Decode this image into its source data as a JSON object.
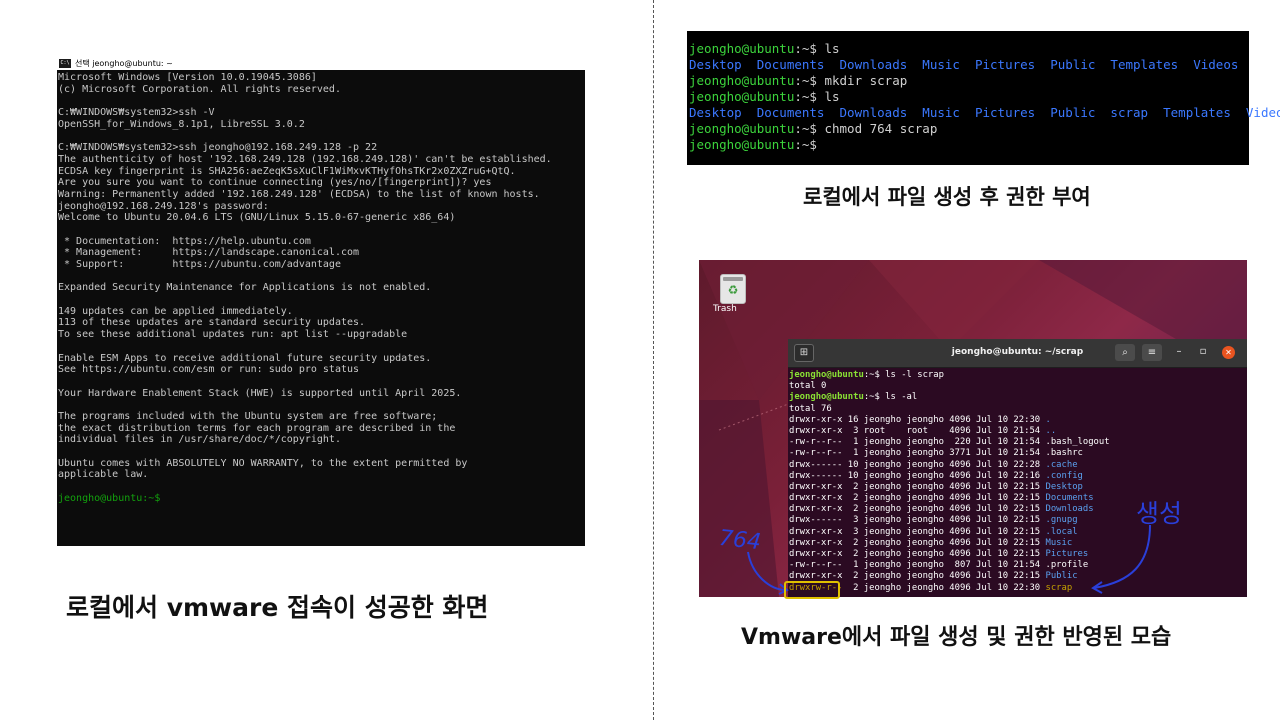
{
  "left_panel": {
    "window_title": "선택 jeongho@ubuntu: ~",
    "icon": "cmd-icon",
    "lines": [
      {
        "t": "Microsoft Windows [Version 10.0.19045.3086]",
        "c": ""
      },
      {
        "t": "(c) Microsoft Corporation. All rights reserved.",
        "c": ""
      },
      {
        "t": "",
        "c": ""
      },
      {
        "t": "C:₩WINDOWS₩system32>ssh -V",
        "c": ""
      },
      {
        "t": "OpenSSH_for_Windows_8.1p1, LibreSSL 3.0.2",
        "c": ""
      },
      {
        "t": "",
        "c": ""
      },
      {
        "t": "C:₩WINDOWS₩system32>ssh jeongho@192.168.249.128 -p 22",
        "c": ""
      },
      {
        "t": "The authenticity of host '192.168.249.128 (192.168.249.128)' can't be established.",
        "c": ""
      },
      {
        "t": "ECDSA key fingerprint is SHA256:aeZeqK5sXuClF1WiMxvKTHyfOhsTKr2x0ZXZruG+QtQ.",
        "c": ""
      },
      {
        "t": "Are you sure you want to continue connecting (yes/no/[fingerprint])? yes",
        "c": ""
      },
      {
        "t": "Warning: Permanently added '192.168.249.128' (ECDSA) to the list of known hosts.",
        "c": ""
      },
      {
        "t": "jeongho@192.168.249.128's password:",
        "c": ""
      },
      {
        "t": "Welcome to Ubuntu 20.04.6 LTS (GNU/Linux 5.15.0-67-generic x86_64)",
        "c": ""
      },
      {
        "t": "",
        "c": ""
      },
      {
        "t": " * Documentation:  https://help.ubuntu.com",
        "c": ""
      },
      {
        "t": " * Management:     https://landscape.canonical.com",
        "c": ""
      },
      {
        "t": " * Support:        https://ubuntu.com/advantage",
        "c": ""
      },
      {
        "t": "",
        "c": ""
      },
      {
        "t": "Expanded Security Maintenance for Applications is not enabled.",
        "c": ""
      },
      {
        "t": "",
        "c": ""
      },
      {
        "t": "149 updates can be applied immediately.",
        "c": ""
      },
      {
        "t": "113 of these updates are standard security updates.",
        "c": ""
      },
      {
        "t": "To see these additional updates run: apt list --upgradable",
        "c": ""
      },
      {
        "t": "",
        "c": ""
      },
      {
        "t": "Enable ESM Apps to receive additional future security updates.",
        "c": ""
      },
      {
        "t": "See https://ubuntu.com/esm or run: sudo pro status",
        "c": ""
      },
      {
        "t": "",
        "c": ""
      },
      {
        "t": "Your Hardware Enablement Stack (HWE) is supported until April 2025.",
        "c": ""
      },
      {
        "t": "",
        "c": ""
      },
      {
        "t": "The programs included with the Ubuntu system are free software;",
        "c": ""
      },
      {
        "t": "the exact distribution terms for each program are described in the",
        "c": ""
      },
      {
        "t": "individual files in /usr/share/doc/*/copyright.",
        "c": ""
      },
      {
        "t": "",
        "c": ""
      },
      {
        "t": "Ubuntu comes with ABSOLUTELY NO WARRANTY, to the extent permitted by",
        "c": ""
      },
      {
        "t": "applicable law.",
        "c": ""
      },
      {
        "t": "",
        "c": ""
      },
      {
        "t": "jeongho@ubuntu:~$",
        "c": "green"
      }
    ],
    "caption": "로컬에서 vmware 접속이 성공한 화면"
  },
  "right_top": {
    "lines": [
      [
        {
          "t": "jeongho@ubuntu",
          "c": "g"
        },
        {
          "t": ":~$ ls",
          "c": ""
        }
      ],
      [
        {
          "t": "Desktop  Documents  Downloads  Music  Pictures  Public  Templates  Videos",
          "c": "b"
        }
      ],
      [
        {
          "t": "jeongho@ubuntu",
          "c": "g"
        },
        {
          "t": ":~$ mkdir scrap",
          "c": ""
        }
      ],
      [
        {
          "t": "jeongho@ubuntu",
          "c": "g"
        },
        {
          "t": ":~$ ls",
          "c": ""
        }
      ],
      [
        {
          "t": "Desktop  Documents  Downloads  Music  Pictures  Public  scrap  Templates  Videos",
          "c": "b"
        }
      ],
      [
        {
          "t": "jeongho@ubuntu",
          "c": "g"
        },
        {
          "t": ":~$ chmod 764 scrap",
          "c": ""
        }
      ],
      [
        {
          "t": "jeongho@ubuntu",
          "c": "g"
        },
        {
          "t": ":~$",
          "c": ""
        }
      ]
    ],
    "caption": "로컬에서 파일 생성 후 권한 부여"
  },
  "right_bottom": {
    "desktop_icon_label": "Trash",
    "terminal_title": "jeongho@ubuntu: ~/scrap",
    "lines": [
      [
        {
          "t": "jeongho@ubuntu",
          "c": "ug"
        },
        {
          "t": ":~$ ls -l scrap",
          "c": ""
        }
      ],
      [
        {
          "t": "total 0",
          "c": ""
        }
      ],
      [
        {
          "t": "jeongho@ubuntu",
          "c": "ug"
        },
        {
          "t": ":~$ ls -al",
          "c": ""
        }
      ],
      [
        {
          "t": "total 76",
          "c": ""
        }
      ],
      [
        {
          "t": "drwxr-xr-x 16 jeongho jeongho 4096 Jul 10 22:30 ",
          "c": ""
        },
        {
          "t": ".",
          "c": "ub"
        }
      ],
      [
        {
          "t": "drwxr-xr-x  3 root    root    4096 Jul 10 21:54 ",
          "c": ""
        },
        {
          "t": "..",
          "c": "ub"
        }
      ],
      [
        {
          "t": "-rw-r--r--  1 jeongho jeongho  220 Jul 10 21:54 .bash_logout",
          "c": ""
        }
      ],
      [
        {
          "t": "-rw-r--r--  1 jeongho jeongho 3771 Jul 10 21:54 .bashrc",
          "c": ""
        }
      ],
      [
        {
          "t": "drwx------ 10 jeongho jeongho 4096 Jul 10 22:28 ",
          "c": ""
        },
        {
          "t": ".cache",
          "c": "ub"
        }
      ],
      [
        {
          "t": "drwx------ 10 jeongho jeongho 4096 Jul 10 22:16 ",
          "c": ""
        },
        {
          "t": ".config",
          "c": "ub"
        }
      ],
      [
        {
          "t": "drwxr-xr-x  2 jeongho jeongho 4096 Jul 10 22:15 ",
          "c": ""
        },
        {
          "t": "Desktop",
          "c": "ub"
        }
      ],
      [
        {
          "t": "drwxr-xr-x  2 jeongho jeongho 4096 Jul 10 22:15 ",
          "c": ""
        },
        {
          "t": "Documents",
          "c": "ub"
        }
      ],
      [
        {
          "t": "drwxr-xr-x  2 jeongho jeongho 4096 Jul 10 22:15 ",
          "c": ""
        },
        {
          "t": "Downloads",
          "c": "ub"
        }
      ],
      [
        {
          "t": "drwx------  3 jeongho jeongho 4096 Jul 10 22:15 ",
          "c": ""
        },
        {
          "t": ".gnupg",
          "c": "ub"
        }
      ],
      [
        {
          "t": "drwxr-xr-x  3 jeongho jeongho 4096 Jul 10 22:15 ",
          "c": ""
        },
        {
          "t": ".local",
          "c": "ub"
        }
      ],
      [
        {
          "t": "drwxr-xr-x  2 jeongho jeongho 4096 Jul 10 22:15 ",
          "c": ""
        },
        {
          "t": "Music",
          "c": "ub"
        }
      ],
      [
        {
          "t": "drwxr-xr-x  2 jeongho jeongho 4096 Jul 10 22:15 ",
          "c": ""
        },
        {
          "t": "Pictures",
          "c": "ub"
        }
      ],
      [
        {
          "t": "-rw-r--r--  1 jeongho jeongho  807 Jul 10 21:54 .profile",
          "c": ""
        }
      ],
      [
        {
          "t": "drwxr-xr-x  2 jeongho jeongho 4096 Jul 10 22:15 ",
          "c": ""
        },
        {
          "t": "Public",
          "c": "ub"
        }
      ],
      [
        {
          "t": "drwxrw-r--",
          "c": "uy"
        },
        {
          "t": "  2 jeongho jeongho 4096 Jul 10 22:30 ",
          "c": ""
        },
        {
          "t": "scrap",
          "c": "uy"
        }
      ]
    ],
    "annotation_left": "764",
    "annotation_right": "생성",
    "caption": "Vmware에서 파일 생성 및 권한 반영된 모습"
  },
  "colors": {
    "cmd_bg": "#0c0c0c",
    "prompt_green": "#13a10e",
    "dir_blue": "#3b78ff",
    "ubuntu_orange": "#e95420",
    "annotation_blue": "#2a3fd9",
    "highlight_yellow": "#e0c000"
  }
}
